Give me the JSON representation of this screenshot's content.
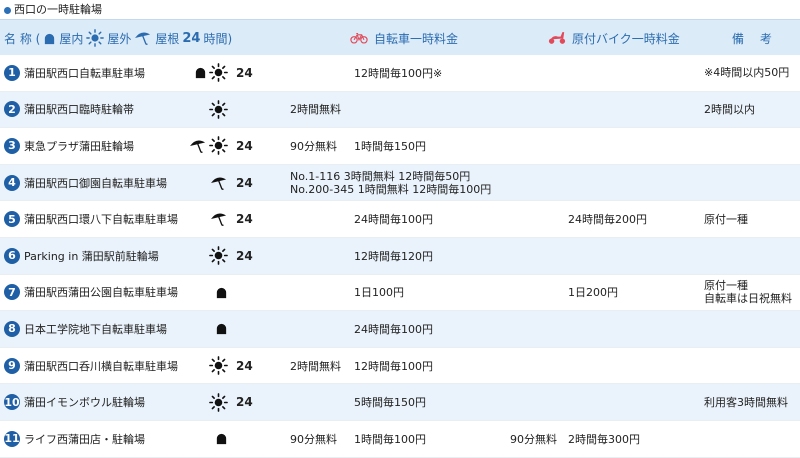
{
  "section_title": "西口の一時駐輪場",
  "header": {
    "name_label": "名 称 (",
    "indoor_label": "屋内",
    "outdoor_label": "屋外",
    "roof_label": "屋根",
    "hours_label": "24",
    "hours_suffix": "時間)",
    "bike_fee_label": "自転車一時料金",
    "moto_fee_label": "原付バイク一時料金",
    "note_label": "備 考"
  },
  "colors": {
    "accent": "#2b6cb0",
    "header_bg": "#dcebf8",
    "row_alt": "#eaf3fb",
    "badge": "#1f5fa6",
    "moto_red": "#e04a5a"
  },
  "rows": [
    {
      "no": "1",
      "name": "蒲田駅西口自転車駐車場",
      "icons": [
        "indoor-icon",
        "sun-icon"
      ],
      "h24": "24",
      "fee1": "",
      "fee2": "12時間毎100円※",
      "moto1": "",
      "moto2": "",
      "note1": "※4時間以内50円",
      "note2": ""
    },
    {
      "no": "2",
      "name": "蒲田駅西口臨時駐輪帯",
      "icons": [
        "sun-icon"
      ],
      "h24": "",
      "fee1": "2時間無料",
      "fee2": "",
      "moto1": "",
      "moto2": "",
      "note1": "2時間以内",
      "note2": ""
    },
    {
      "no": "3",
      "name": "東急プラザ蒲田駐輪場",
      "icons": [
        "umbrella-icon",
        "sun-icon"
      ],
      "h24": "24",
      "fee1": "90分無料",
      "fee2": "1時間毎150円",
      "moto1": "",
      "moto2": "",
      "note1": "",
      "note2": ""
    },
    {
      "no": "4",
      "name": "蒲田駅西口御園自転車駐車場",
      "icons": [
        "umbrella-icon"
      ],
      "h24": "24",
      "multi1": "No.1-116 3時間無料 12時間毎50円",
      "multi2": "No.200-345 1時間無料 12時間毎100円",
      "moto1": "",
      "moto2": "",
      "note1": "",
      "note2": ""
    },
    {
      "no": "5",
      "name": "蒲田駅西口環八下自転車駐車場",
      "icons": [
        "umbrella-icon"
      ],
      "h24": "24",
      "fee1": "",
      "fee2": "24時間毎100円",
      "moto1": "",
      "moto2": "24時間毎200円",
      "note1": "原付一種",
      "note2": ""
    },
    {
      "no": "6",
      "name": "Parking in 蒲田駅前駐輪場",
      "icons": [
        "sun-icon"
      ],
      "h24": "24",
      "fee1": "",
      "fee2": "12時間毎120円",
      "moto1": "",
      "moto2": "",
      "note1": "",
      "note2": ""
    },
    {
      "no": "7",
      "name": "蒲田駅西蒲田公園自転車駐車場",
      "icons": [
        "indoor-icon"
      ],
      "h24": "",
      "fee1": "",
      "fee2": "1日100円",
      "moto1": "",
      "moto2": "1日200円",
      "note1": "原付一種",
      "note2": "自転車は日祝無料"
    },
    {
      "no": "8",
      "name": "日本工学院地下自転車駐車場",
      "icons": [
        "indoor-icon"
      ],
      "h24": "",
      "fee1": "",
      "fee2": "24時間毎100円",
      "moto1": "",
      "moto2": "",
      "note1": "",
      "note2": ""
    },
    {
      "no": "9",
      "name": "蒲田駅西口呑川横自転車駐車場",
      "icons": [
        "sun-icon"
      ],
      "h24": "24",
      "fee1": "2時間無料",
      "fee2": "12時間毎100円",
      "moto1": "",
      "moto2": "",
      "note1": "",
      "note2": ""
    },
    {
      "no": "10",
      "name": "蒲田イモンボウル駐輪場",
      "icons": [
        "sun-icon"
      ],
      "h24": "24",
      "fee1": "",
      "fee2": "5時間毎150円",
      "moto1": "",
      "moto2": "",
      "note1": "利用客3時間無料",
      "note2": ""
    },
    {
      "no": "11",
      "name": "ライフ西蒲田店・駐輪場",
      "icons": [
        "indoor-icon"
      ],
      "h24": "",
      "fee1": "90分無料",
      "fee2": "1時間毎100円",
      "moto1": "90分無料",
      "moto2": "2時間毎300円",
      "note1": "",
      "note2": ""
    }
  ]
}
